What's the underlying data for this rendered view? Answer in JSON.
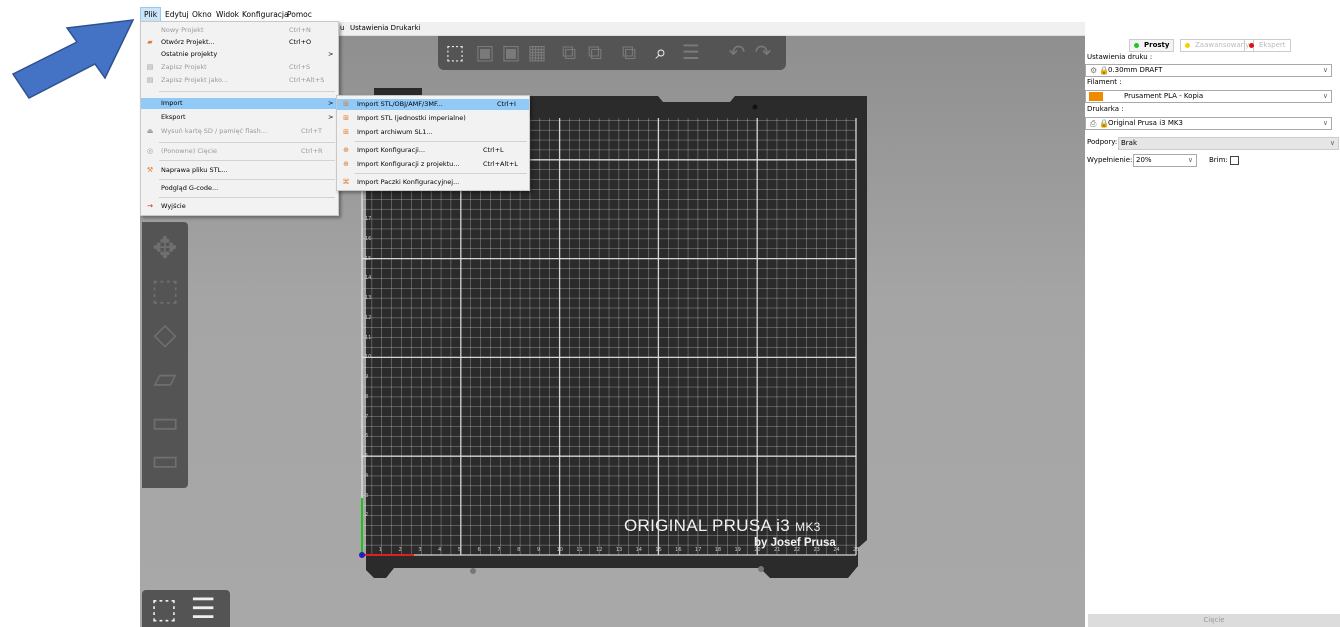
{
  "menubar": {
    "items": [
      "Plik",
      "Edytuj",
      "Okno",
      "Widok",
      "Konfiguracja",
      "Pomoc"
    ]
  },
  "tabs": {
    "partial": "u",
    "printer_settings": "Ustawienia Drukarki"
  },
  "file_menu": {
    "new_project": {
      "label": "Nowy Projekt",
      "shortcut": "Ctrl+N"
    },
    "open_project": {
      "label": "Otwórz Projekt...",
      "shortcut": "Ctrl+O"
    },
    "recent_projects": {
      "label": "Ostatnie projekty",
      "arrow": ">"
    },
    "save_project": {
      "label": "Zapisz Projekt",
      "shortcut": "Ctrl+S"
    },
    "save_project_as": {
      "label": "Zapisz Projekt jako...",
      "shortcut": "Ctrl+Alt+S"
    },
    "import": {
      "label": "Import",
      "arrow": ">"
    },
    "export": {
      "label": "Eksport",
      "arrow": ">"
    },
    "eject_sd": {
      "label": "Wysuń kartę SD / pamięć flash...",
      "shortcut": "Ctrl+T"
    },
    "reslice": {
      "label": "(Ponowne) Cięcie",
      "shortcut": "Ctrl+R"
    },
    "repair_stl": {
      "label": "Naprawa pliku STL..."
    },
    "gcode_preview": {
      "label": "Podgląd G-code..."
    },
    "quit": {
      "label": "Wyjście"
    }
  },
  "import_menu": {
    "stl": {
      "label": "Import STL/OBJ/AMF/3MF...",
      "shortcut": "Ctrl+I"
    },
    "stl_imperial": {
      "label": "Import STL (jednostki imperialne)"
    },
    "sl1": {
      "label": "Import archiwum SL1..."
    },
    "config": {
      "label": "Import Konfiguracji...",
      "shortcut": "Ctrl+L"
    },
    "config_project": {
      "label": "Import Konfiguracji z projektu...",
      "shortcut": "Ctrl+Alt+L"
    },
    "bundle": {
      "label": "Import Paczki Konfiguracyjnej..."
    }
  },
  "bed": {
    "x_labels": [
      "1",
      "2",
      "3",
      "4",
      "5",
      "6",
      "7",
      "8",
      "9",
      "10",
      "11",
      "12",
      "13",
      "14",
      "15",
      "16",
      "17",
      "18",
      "19",
      "20",
      "21",
      "22",
      "23",
      "24",
      "25"
    ],
    "y_labels": [
      "2",
      "3",
      "4",
      "5",
      "6",
      "7",
      "8",
      "9",
      "10",
      "11",
      "12",
      "13",
      "14",
      "15",
      "16",
      "17"
    ],
    "brand": "ORIGINAL PRUSA i3",
    "model": "MK3",
    "byline": "by Josef Prusa"
  },
  "right_panel": {
    "modes": [
      "Prosty",
      "Zaawansowany",
      "Ekspert"
    ],
    "mode_colors": [
      "#27c227",
      "#f5d300",
      "#e01010"
    ],
    "print_settings_label": "Ustawienia druku :",
    "print_settings_value": "0.30mm DRAFT",
    "filament_label": "Filament :",
    "filament_value": "Prusament PLA - Kopia",
    "filament_color": "#f08a00",
    "printer_label": "Drukarka :",
    "printer_value": "Original Prusa i3 MK3",
    "supports_label": "Podpory:",
    "supports_value": "Brak",
    "infill_label": "Wypełnienie:",
    "infill_value": "20%",
    "brim_label": "Brim:",
    "slice_button": "Cięcie"
  }
}
